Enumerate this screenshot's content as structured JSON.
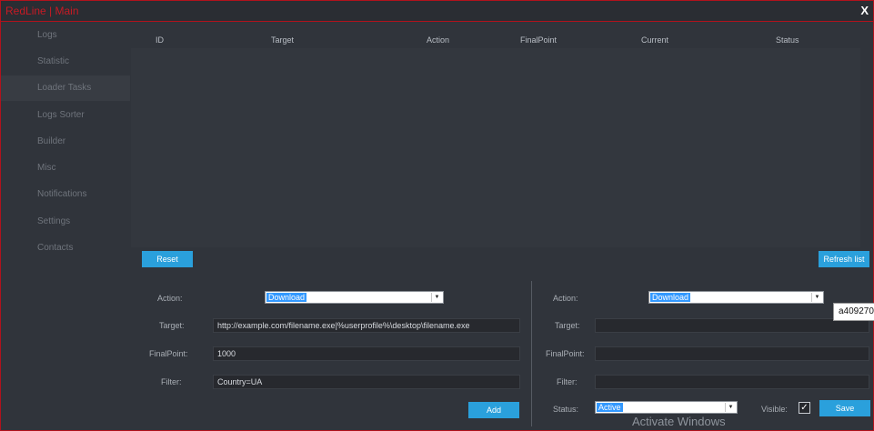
{
  "window": {
    "title": "RedLine | Main",
    "close_label": "X"
  },
  "sidebar": {
    "items": [
      {
        "label": "Logs"
      },
      {
        "label": "Statistic"
      },
      {
        "label": "Loader Tasks",
        "active": true
      },
      {
        "label": "Logs Sorter"
      },
      {
        "label": "Builder"
      },
      {
        "label": "Misc"
      },
      {
        "label": "Notifications"
      },
      {
        "label": "Settings"
      },
      {
        "label": "Contacts"
      }
    ]
  },
  "table": {
    "columns": [
      "ID",
      "Target",
      "Action",
      "FinalPoint",
      "Current",
      "Status"
    ],
    "rows": []
  },
  "buttons": {
    "reset": "Reset",
    "refresh": "Refresh list",
    "add": "Add",
    "save": "Save"
  },
  "left_form": {
    "action_label": "Action:",
    "action_value": "Download",
    "target_label": "Target:",
    "target_value": "http://example.com/filename.exe|%userprofile%\\desktop\\filename.exe",
    "finalpoint_label": "FinalPoint:",
    "finalpoint_value": "1000",
    "filter_label": "Filter:",
    "filter_value": "Country=UA"
  },
  "right_form": {
    "action_label": "Action:",
    "action_value": "Download",
    "target_label": "Target:",
    "target_value": "",
    "finalpoint_label": "FinalPoint:",
    "finalpoint_value": "",
    "filter_label": "Filter:",
    "filter_value": "",
    "status_label": "Status:",
    "status_value": "Active",
    "visible_label": "Visible:",
    "visible_checked": true
  },
  "tooltip": {
    "text": "a409270"
  },
  "watermark": {
    "text": "Activate Windows"
  },
  "colors": {
    "border": "#b1121c",
    "accent": "#2aa0dc",
    "title": "#c61a24"
  }
}
